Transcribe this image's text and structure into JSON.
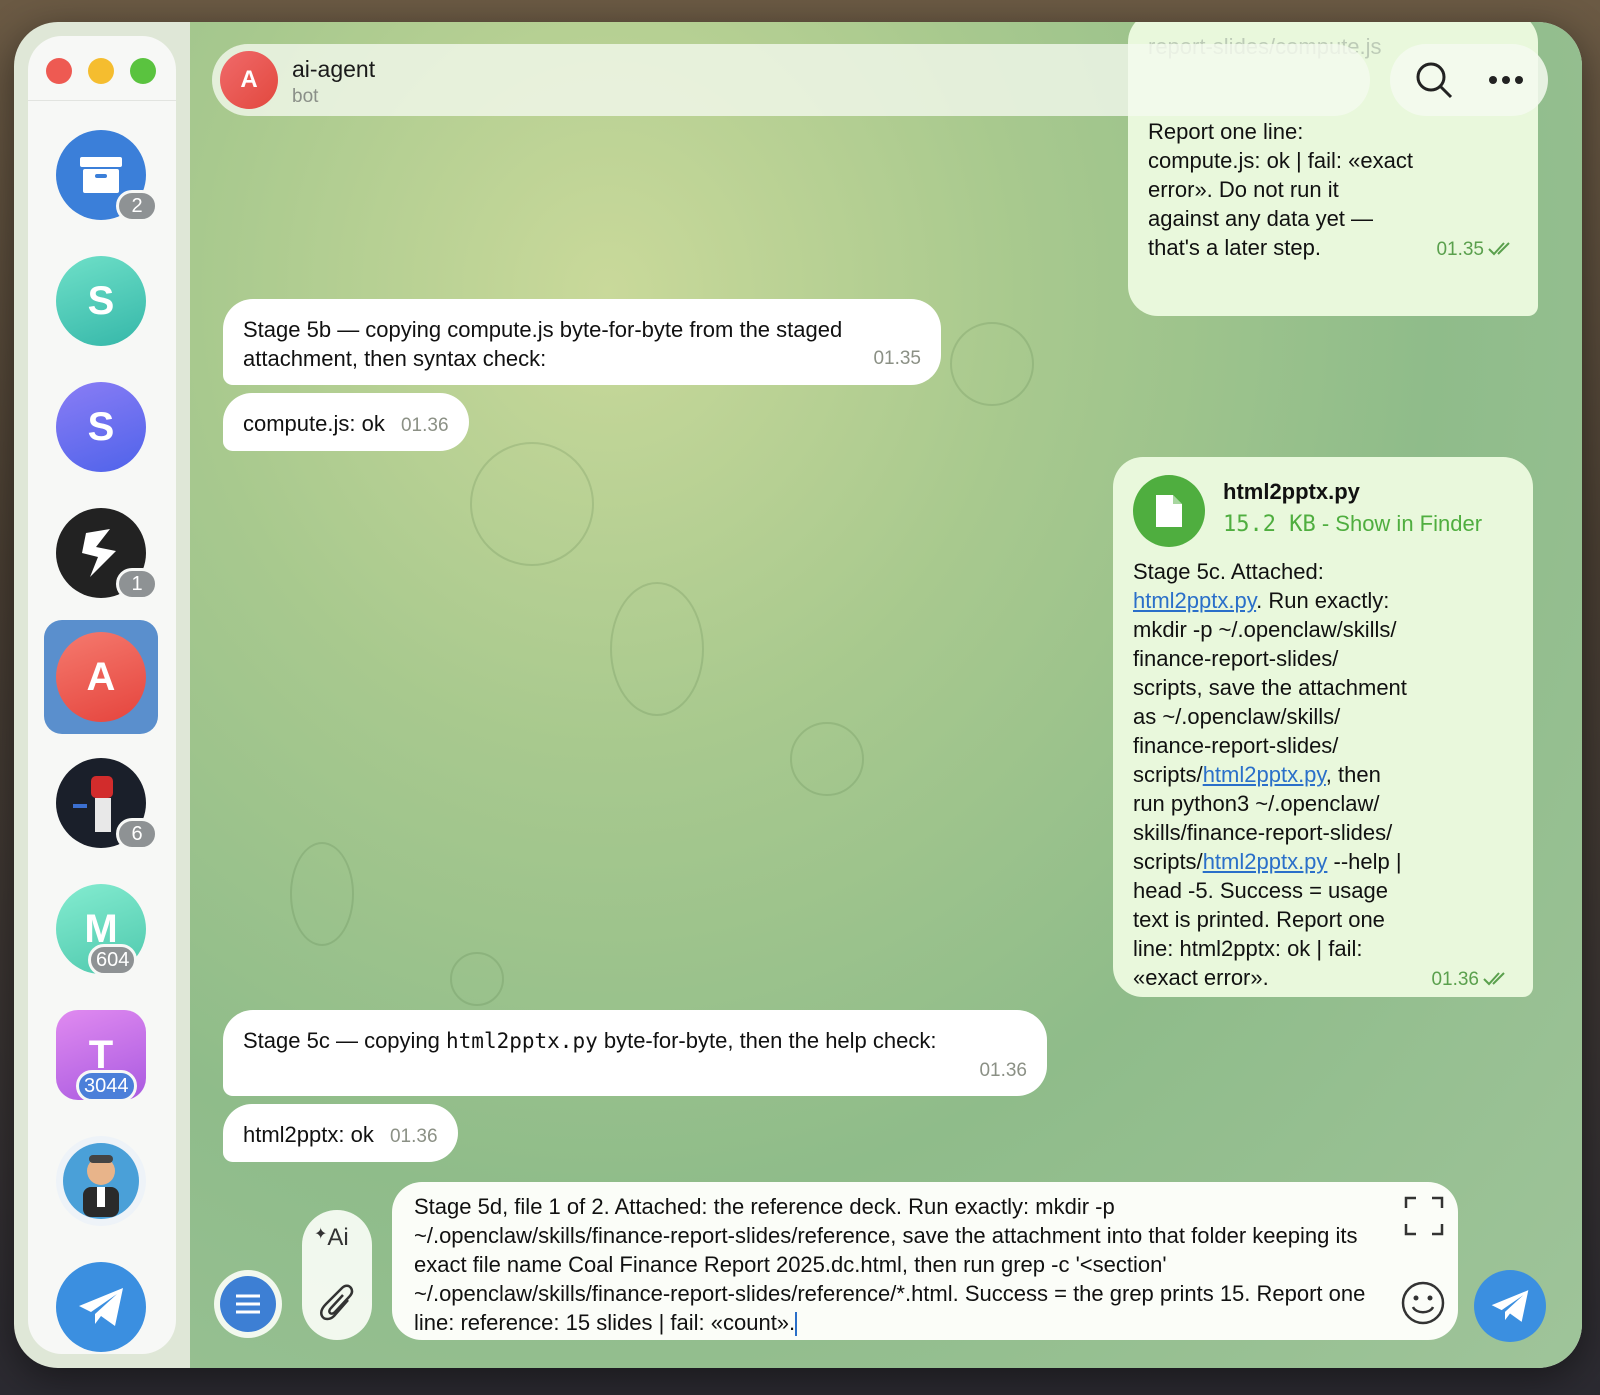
{
  "window": {
    "traffic_lights": [
      "close",
      "minimize",
      "zoom"
    ]
  },
  "sidebar": {
    "items": [
      {
        "name": "archive",
        "letter": "",
        "icon": "archive-icon",
        "badge": "2",
        "color": "#3b7fd9",
        "active": false
      },
      {
        "name": "chat-s-teal",
        "letter": "S",
        "badge": "",
        "color": "#4cc7b5",
        "active": false
      },
      {
        "name": "chat-s-purple",
        "letter": "S",
        "badge": "",
        "color": "#6b6ef0",
        "active": false
      },
      {
        "name": "chat-dark-logo",
        "letter": "",
        "icon": "logo-icon",
        "badge": "1",
        "color": "#222222",
        "active": false
      },
      {
        "name": "chat-ai-agent",
        "letter": "A",
        "badge": "",
        "color": "#ec5a55",
        "active": true
      },
      {
        "name": "chat-fist-photo",
        "letter": "",
        "icon": "fist-photo-icon",
        "badge": "6",
        "color": "#1a1f2a",
        "active": false
      },
      {
        "name": "chat-m",
        "letter": "M",
        "badge": "604",
        "color": "#5fd6b8",
        "active": false
      },
      {
        "name": "chat-t",
        "letter": "T",
        "badge": "3044",
        "color": "#c46ee8",
        "active": false
      },
      {
        "name": "chat-cartoon",
        "letter": "",
        "icon": "cartoon-avatar-icon",
        "badge": "",
        "color": "#4aa0d8",
        "active": false
      },
      {
        "name": "telegram",
        "letter": "",
        "icon": "telegram-icon",
        "badge": "",
        "color": "#3b8fe0",
        "active": false
      }
    ]
  },
  "header": {
    "avatar_letter": "A",
    "title": "ai-agent",
    "subtitle": "bot",
    "search_icon": "search-icon",
    "more_icon": "more-icon",
    "obscured_text": "report-slides/compute.js"
  },
  "messages": {
    "m1": {
      "lines": [
        "Report one line:",
        "compute.js: ok | fail: «exact",
        "error». Do not run it",
        "against any data yet —",
        "that's a later step."
      ],
      "time": "01.35"
    },
    "m2": {
      "text": "Stage 5b — copying compute.js byte-for-byte from the staged attachment, then syntax check:",
      "time": "01.35"
    },
    "m3": {
      "text": "compute.js: ok",
      "time": "01.36"
    },
    "m4": {
      "file_name": "html2pptx.py",
      "file_size": "15.2 KB",
      "file_action": "Show in Finder",
      "p1": "Stage 5c. Attached:",
      "link": "html2pptx.py",
      "p2": ". Run exactly:",
      "p3": "mkdir -p ~/.openclaw/skills/",
      "p4": "finance-report-slides/",
      "p5": "scripts, save the attachment",
      "p6": "as ~/.openclaw/skills/",
      "p7": "finance-report-slides/",
      "p8a": "scripts/",
      "p8b": ", then",
      "p9": "run python3 ~/.openclaw/",
      "p10": "skills/finance-report-slides/",
      "p11a": "scripts/",
      "p11b": " --help |",
      "p12": "head -5. Success = usage",
      "p13": "text is printed. Report one",
      "p14": "line: html2pptx: ok | fail:",
      "p15": "«exact error».",
      "time": "01.36"
    },
    "m5": {
      "pre": "Stage 5c — copying ",
      "code": "html2pptx.py",
      "post": " byte-for-byte, then the help check:",
      "time": "01.36"
    },
    "m6": {
      "text": "html2pptx: ok",
      "time": "01.36"
    }
  },
  "composer": {
    "text": "Stage 5d, file 1 of 2. Attached: the reference deck. Run exactly: mkdir -p ~/.openclaw/skills/finance-report-slides/reference, save the attachment into that folder keeping its exact file name Coal Finance Report 2025.dc.html, then run grep -c '<section' ~/.openclaw/skills/finance-report-slides/reference/*.html. Success = the grep prints 15. Report one line: reference: 15 slides | fail: «count».",
    "ai_label": "Ai",
    "menu_icon": "menu-icon",
    "attach_icon": "paperclip-icon",
    "expand_icon": "expand-icon",
    "emoji_icon": "emoji-icon",
    "send_icon": "send-icon"
  }
}
